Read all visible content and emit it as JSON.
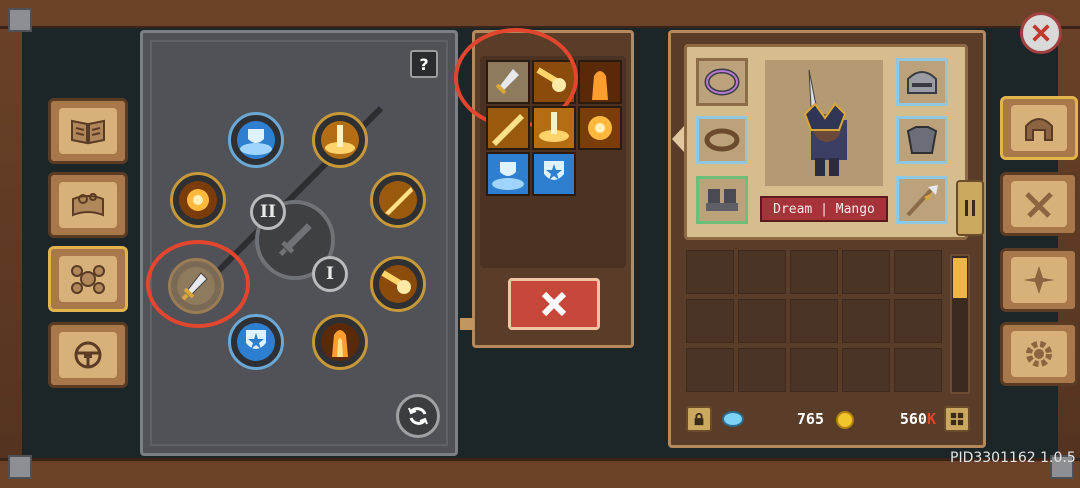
{
  "help_label": "?",
  "roman_two": "II",
  "roman_one": "I",
  "character_name": "Dream | Mango",
  "gems_value": "765",
  "gold_value": "560",
  "gold_suffix": "K",
  "build_info": "PID3301162 1.0.5",
  "colors": {
    "highlight_ring": "#e2462e",
    "wood": "#6b4127",
    "stone": "#505257",
    "gold": "#f0b547"
  },
  "icons": {
    "left_tabs": [
      "book-icon",
      "map-scroll-icon",
      "skill-tree-icon",
      "steering-wheel-icon"
    ],
    "right_tabs": [
      "helmet-icon",
      "swords-icon",
      "compass-icon",
      "gear-icon"
    ]
  }
}
